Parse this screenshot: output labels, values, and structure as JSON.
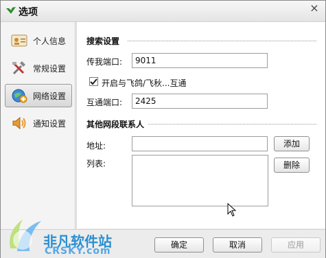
{
  "window": {
    "title": "选项"
  },
  "sidebar": {
    "items": [
      {
        "label": "个人信息",
        "icon": "contact-card-icon"
      },
      {
        "label": "常规设置",
        "icon": "tools-icon"
      },
      {
        "label": "网络设置",
        "icon": "network-globe-icon",
        "active": true
      },
      {
        "label": "通知设置",
        "icon": "speaker-icon"
      }
    ]
  },
  "search": {
    "section_title": "搜索设置",
    "port_label": "传我端口:",
    "port_value": "9011",
    "interop_label": "开启与飞鸽/飞秋...互通",
    "interop_checked": true,
    "interop_port_label": "互通端口:",
    "interop_port_value": "2425"
  },
  "contacts": {
    "section_title": "其他网段联系人",
    "address_label": "地址:",
    "address_value": "",
    "list_label": "列表:",
    "add_button": "添加",
    "delete_button": "删除"
  },
  "footer": {
    "ok_button": "确定",
    "cancel_button": "取消",
    "apply_button": "应用"
  },
  "watermark": {
    "cn": "非凡软件站",
    "en": "CRSKY.com"
  }
}
